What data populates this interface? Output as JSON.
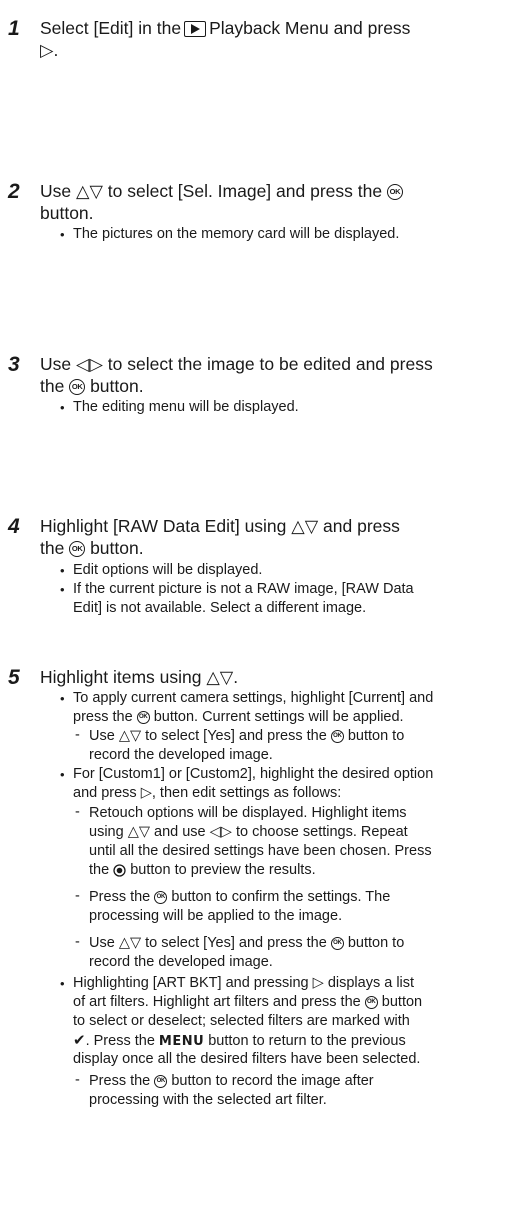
{
  "steps": [
    {
      "num": "1",
      "line1_pre": "Select [Edit] in the",
      "line1_post": "Playback Menu and press",
      "line2": "▷."
    },
    {
      "num": "2",
      "line1_pre": "Use △▽ to select [Sel. Image] and press the",
      "line2": "button.",
      "bullet1": "The pictures on the memory card will be displayed."
    },
    {
      "num": "3",
      "line1": "Use ◁▷ to select the image to be edited and press",
      "line2_pre": "the",
      "line2_post": "button.",
      "bullet1": "The editing menu will be displayed."
    },
    {
      "num": "4",
      "line1": "Highlight [RAW Data Edit] using △▽ and press",
      "line2_pre": "the",
      "line2_post": "button.",
      "bullet1": "Edit options will be displayed.",
      "bullet2_l1": "If the current picture is not a RAW image, [RAW Data",
      "bullet2_l2": "Edit] is not available. Select a different image."
    },
    {
      "num": "5",
      "line1": "Highlight items using △▽.",
      "b1_l1": "To apply current camera settings, highlight [Current] and",
      "b1_l2_pre": "press the",
      "b1_l2_post": "button. Current settings will be applied.",
      "d1_l1_pre": "Use △▽ to select [Yes] and press the",
      "d1_l1_post": "button to",
      "d1_l2": "record the developed image.",
      "b2_l1": "For [Custom1] or [Custom2], highlight the desired option",
      "b2_l2": "and press ▷, then edit settings as follows:",
      "d2_l1": "Retouch options will be displayed. Highlight items",
      "d2_l2": "using △▽ and use ◁▷ to choose settings. Repeat",
      "d2_l3": "until all the desired settings have been chosen. Press",
      "d2_l4_pre": "the",
      "d2_l4_post": "button to preview the results.",
      "d3_l1_pre": "Press the",
      "d3_l1_post": "button to confirm the settings. The",
      "d3_l2": "processing will be applied to the image.",
      "d4_l1_pre": "Use △▽ to select [Yes] and press the",
      "d4_l1_post": "button to",
      "d4_l2": "record the developed image.",
      "b3_l1": "Highlighting [ART BKT] and pressing ▷ displays a list",
      "b3_l2_pre": "of art filters. Highlight art filters and press the",
      "b3_l2_post": "button",
      "b3_l3": "to select or deselect; selected filters are marked with",
      "b3_l4_pre": ". Press the",
      "b3_l4_menu": "MENU",
      "b3_l4_post": "button to return to the previous",
      "b3_l5": "display once all the desired filters have been selected.",
      "d5_l1_pre": "Press the",
      "d5_l1_post": "button to record the image after",
      "d5_l2": "processing with the selected art filter."
    }
  ],
  "icons": {
    "ok_text": "OK",
    "check": "✔",
    "bullet": "•",
    "dash": "-"
  }
}
